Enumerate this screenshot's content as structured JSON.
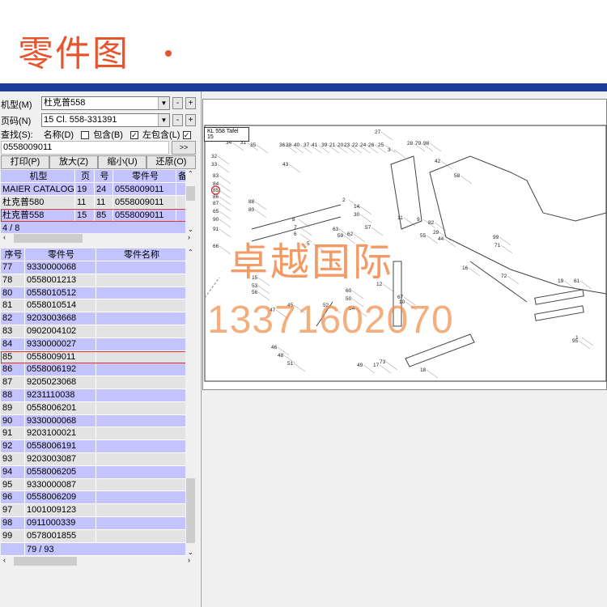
{
  "page_title": "零件图",
  "colors": {
    "accent": "#e8552c",
    "titlebar": "#1c3d9a",
    "grid_blue": "#c3c3ff",
    "grid_gray": "#e3e3e3",
    "selection": "#e03030"
  },
  "controls": {
    "model_label": "机型(M)",
    "model_value": "杜克普558",
    "page_label": "页码(N)",
    "page_value": "15 Cl. 558-331391",
    "minus": "-",
    "plus": "+",
    "search_label": "查找(S):",
    "name_label": "名称(D)",
    "contains_label": "包含(B)",
    "left_contains_label": "左包含(L)",
    "contains_checked": false,
    "left_contains_checked": true,
    "name_checked": false,
    "extra_checked": true,
    "search_value": "0558009011",
    "go": ">>",
    "print": "打印(P)",
    "zoom_in": "放大(Z)",
    "zoom_out": "缩小(U)",
    "restore": "还原(O)"
  },
  "model_table": {
    "headers": [
      "机型",
      "页",
      "号",
      "零件号",
      "备"
    ],
    "rows": [
      [
        "MAIER CATALOG",
        "19",
        "24",
        "0558009011"
      ],
      [
        "杜克普580",
        "11",
        "11",
        "0558009011"
      ],
      [
        "杜克普558",
        "15",
        "85",
        "0558009011"
      ]
    ],
    "selected_index": 2,
    "footer": "4 / 8"
  },
  "parts_table": {
    "headers": [
      "序号",
      "零件号",
      "零件名称"
    ],
    "rows": [
      [
        "77",
        "9330000068"
      ],
      [
        "78",
        "0558001213"
      ],
      [
        "80",
        "0558010512"
      ],
      [
        "81",
        "0558010514"
      ],
      [
        "82",
        "9203003668"
      ],
      [
        "83",
        "0902004102"
      ],
      [
        "84",
        "9330000027"
      ],
      [
        "85",
        "0558009011"
      ],
      [
        "86",
        "0558006192"
      ],
      [
        "87",
        "9205023068"
      ],
      [
        "88",
        "9231110038"
      ],
      [
        "89",
        "0558006201"
      ],
      [
        "90",
        "9330000068"
      ],
      [
        "91",
        "9203100021"
      ],
      [
        "92",
        "0558006191"
      ],
      [
        "93",
        "9203003087"
      ],
      [
        "94",
        "0558006205"
      ],
      [
        "95",
        "9330000087"
      ],
      [
        "96",
        "0558006209"
      ],
      [
        "97",
        "1001009123"
      ],
      [
        "98",
        "0911000339"
      ],
      [
        "99",
        "0578001855"
      ]
    ],
    "selected_index": 7,
    "footer": "79 / 93"
  },
  "drawing": {
    "plate_label": "KL 558 Tafel 15",
    "highlighted_callout": "85",
    "callouts": [
      "34",
      "31",
      "35",
      "32",
      "33",
      "83",
      "84",
      "85",
      "86",
      "87",
      "65",
      "90",
      "91",
      "66",
      "88",
      "80",
      "36",
      "38",
      "40",
      "37",
      "41",
      "39",
      "21",
      "20",
      "23",
      "22",
      "24",
      "26",
      "25",
      "27",
      "28",
      "79",
      "98",
      "3",
      "42",
      "43",
      "2",
      "14",
      "30",
      "11",
      "12",
      "67",
      "10",
      "52",
      "54",
      "15",
      "53",
      "56",
      "60",
      "50",
      "45",
      "47",
      "46",
      "48",
      "51",
      "49",
      "17",
      "18",
      "19",
      "61",
      "57",
      "62",
      "59",
      "63",
      "5",
      "6",
      "7",
      "8",
      "29",
      "44",
      "55",
      "9",
      "82",
      "95",
      "99",
      "71",
      "73",
      "72",
      "1",
      "58",
      "16"
    ],
    "watermark_name": "卓越国际",
    "watermark_phone": "13371602070"
  }
}
